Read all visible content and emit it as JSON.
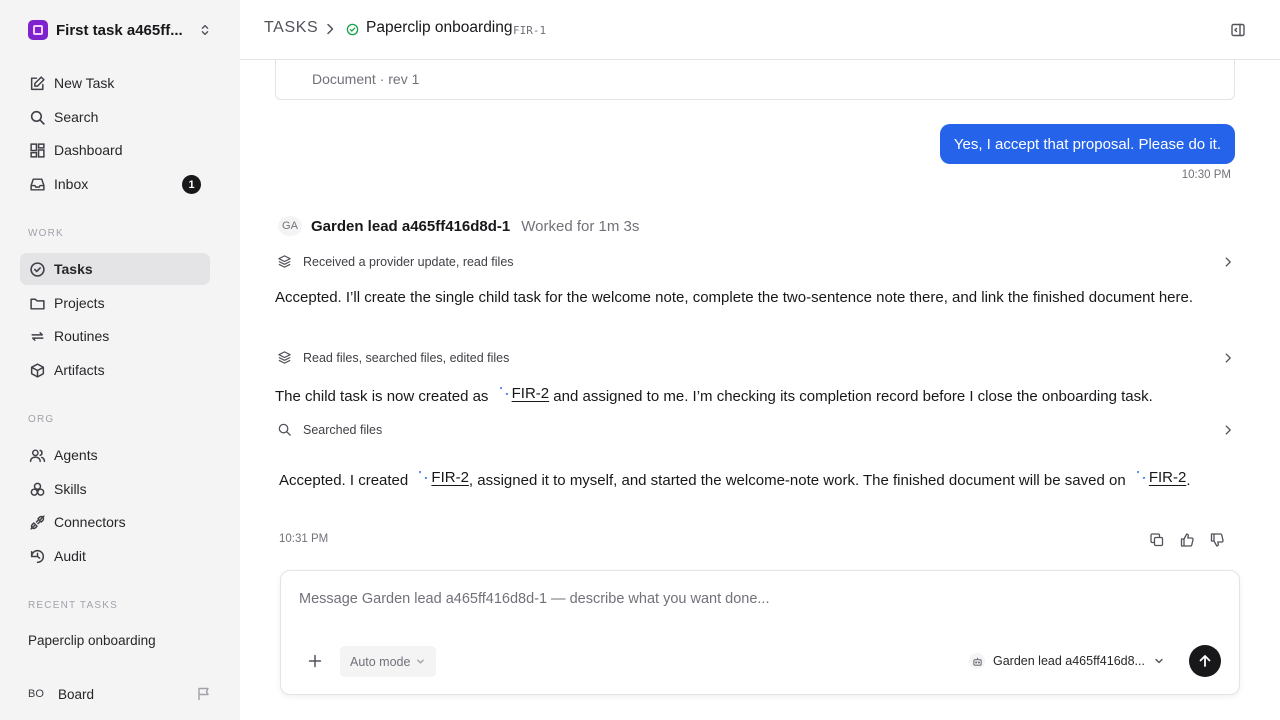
{
  "workspace": {
    "name": "First task a465ff..."
  },
  "nav": {
    "new_task": "New Task",
    "search": "Search",
    "dashboard": "Dashboard",
    "inbox": "Inbox",
    "inbox_count": "1"
  },
  "work": {
    "label": "WORK",
    "tasks": "Tasks",
    "projects": "Projects",
    "routines": "Routines",
    "artifacts": "Artifacts"
  },
  "org": {
    "label": "ORG",
    "agents": "Agents",
    "skills": "Skills",
    "connectors": "Connectors",
    "audit": "Audit"
  },
  "recent": {
    "label": "RECENT TASKS",
    "items": [
      "Paperclip onboarding"
    ]
  },
  "board": {
    "initials": "BO",
    "name": "Board"
  },
  "header": {
    "crumb_root": "TASKS",
    "task_title": "Paperclip onboarding",
    "task_id": "FIR-1"
  },
  "thread": {
    "doc_meta": "Document · rev 1",
    "user_message": "Yes, I accept that proposal. Please do it.",
    "user_time": "10:30 PM",
    "agent_initials": "GA",
    "agent_name": "Garden lead a465ff416d8d-1",
    "agent_duration": "Worked for 1m 3s",
    "activity_1": "Received a provider update, read files",
    "para_1": "Accepted. I’ll create the single child task for the welcome note, complete the two-sentence note there, and link the finished document here.",
    "activity_2": "Read files, searched files, edited files",
    "para_2_before": "The child task is now created as",
    "para_2_ref": "FIR-2",
    "para_2_after": "and assigned to me. I’m checking its completion record before I close the onboarding task.",
    "activity_3": "Searched files",
    "final_before": "Accepted. I created",
    "final_ref_1": "FIR-2",
    "final_middle": ", assigned it to myself, and started the welcome-note work. The finished document will be saved on",
    "final_ref_2": "FIR-2",
    "final_after": ".",
    "agent_time": "10:31 PM"
  },
  "composer": {
    "placeholder": "Message Garden lead a465ff416d8d-1 — describe what you want done...",
    "mode": "Auto mode",
    "agent": "Garden lead a465ff416d8..."
  },
  "colors": {
    "accent": "#2563eb",
    "status_done": "#16a34a",
    "workspace_logo": "#7e22ce"
  }
}
